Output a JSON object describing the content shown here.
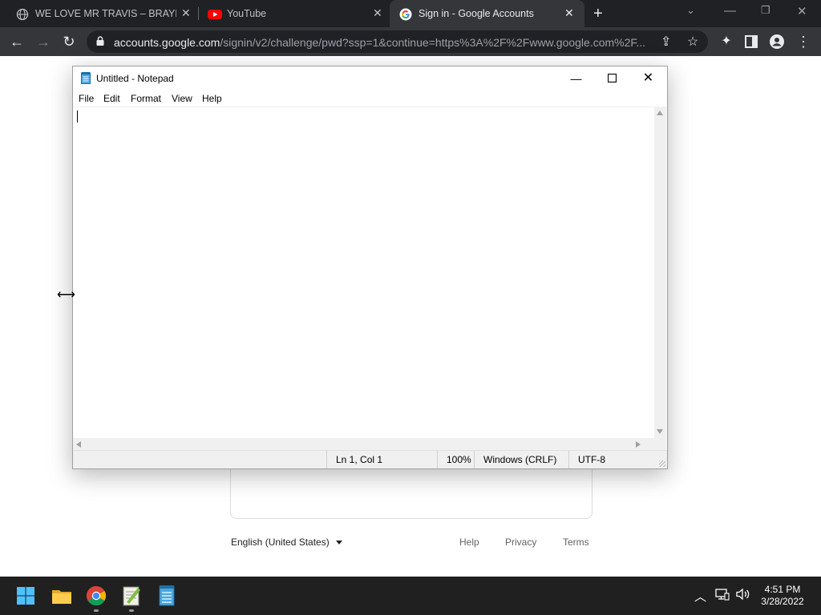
{
  "browser": {
    "tabs": [
      {
        "title": "WE LOVE MR TRAVIS – BRAYLIN.C",
        "icon": "globe-icon"
      },
      {
        "title": "YouTube",
        "icon": "youtube-icon"
      },
      {
        "title": "Sign in - Google Accounts",
        "icon": "google-icon",
        "active": true
      }
    ],
    "url_host": "accounts.google.com",
    "url_path": "/signin/v2/challenge/pwd?ssp=1&continue=https%3A%2F%2Fwww.google.com%2F..."
  },
  "google_page": {
    "language": "English (United States)",
    "footer_links": [
      "Help",
      "Privacy",
      "Terms"
    ]
  },
  "notepad": {
    "title": "Untitled - Notepad",
    "menu": [
      "File",
      "Edit",
      "Format",
      "View",
      "Help"
    ],
    "content": "",
    "status": {
      "position": "Ln 1, Col 1",
      "zoom": "100%",
      "line_ending": "Windows (CRLF)",
      "encoding": "UTF-8"
    }
  },
  "taskbar": {
    "time": "4:51 PM",
    "date": "3/28/2022",
    "apps": [
      "start-icon",
      "file-explorer-icon",
      "chrome-icon",
      "notepadplusplus-icon",
      "notepad-icon"
    ]
  },
  "colors": {
    "chrome_frame": "#202124",
    "chrome_toolbar": "#35363a",
    "taskbar": "#202020",
    "windows_blue": "#0078d4"
  }
}
